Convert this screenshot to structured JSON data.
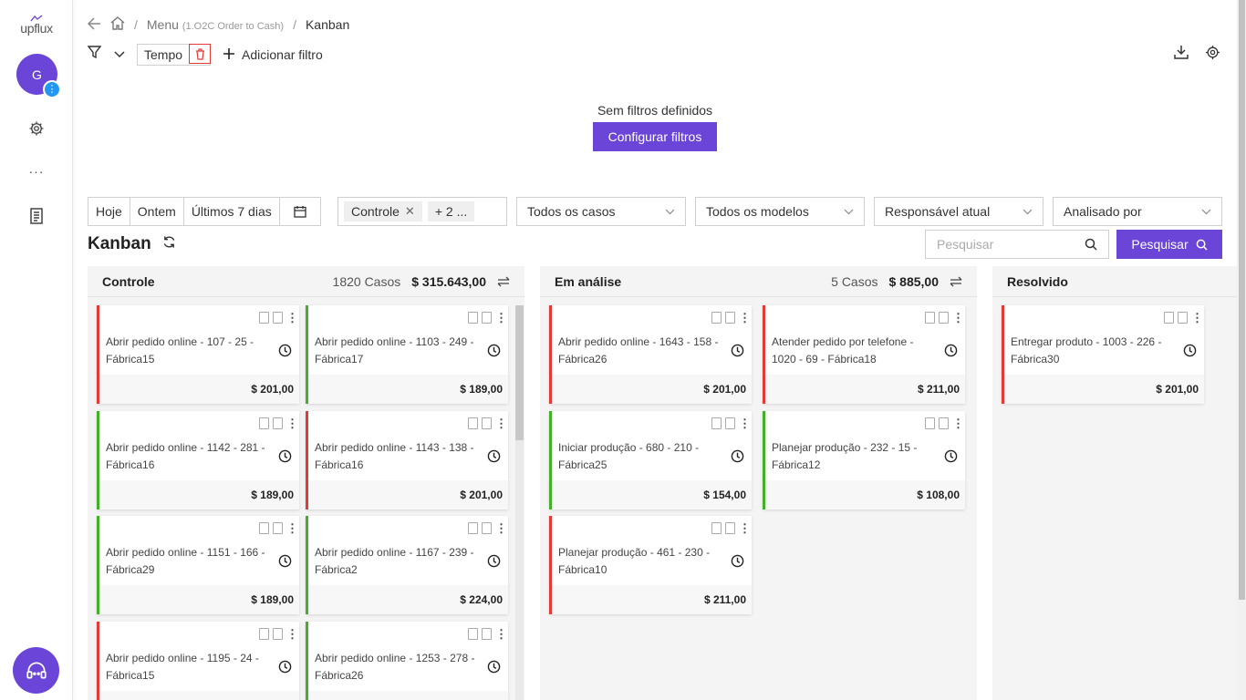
{
  "app": {
    "logo": "upflux",
    "avatar_initial": "G",
    "avatar_badge": "⋮",
    "sidebar_more": "···"
  },
  "breadcrumb": {
    "menu": "Menu",
    "menu_sub": "(1.O2C Order to Cash)",
    "current": "Kanban"
  },
  "filters": {
    "tempo_label": "Tempo",
    "add_filter_label": "Adicionar filtro",
    "empty_title": "Sem filtros definidos",
    "configure_label": "Configurar filtros"
  },
  "date_range": {
    "today": "Hoje",
    "yesterday": "Ontem",
    "last7": "Últimos 7 dias"
  },
  "activity_filter": {
    "chip": "Controle",
    "more": "+ 2 ..."
  },
  "selects": {
    "cases": "Todos os casos",
    "models": "Todos os modelos",
    "responsible": "Responsável atual",
    "analyzed": "Analisado por"
  },
  "kanban": {
    "title": "Kanban",
    "search_placeholder": "Pesquisar",
    "search_button": "Pesquisar"
  },
  "colors": {
    "accent": "#6a45d8",
    "late": "#e53935",
    "on_time": "#43b02a"
  },
  "columns": [
    {
      "name": "Controle",
      "count": "1820 Casos",
      "total": "$ 315.643,00",
      "cards": [
        {
          "title": "Abrir pedido online - 107 - 25 - Fábrica15",
          "value": "$ 201,00",
          "status": "red"
        },
        {
          "title": "Abrir pedido online - 1103 - 249 - Fábrica17",
          "value": "$ 189,00",
          "status": "green"
        },
        {
          "title": "Abrir pedido online - 1142 - 281 - Fábrica16",
          "value": "$ 189,00",
          "status": "green"
        },
        {
          "title": "Abrir pedido online - 1143 - 138 - Fábrica16",
          "value": "$ 201,00",
          "status": "red"
        },
        {
          "title": "Abrir pedido online - 1151 - 166 - Fábrica29",
          "value": "$ 189,00",
          "status": "green"
        },
        {
          "title": "Abrir pedido online - 1167 - 239 - Fábrica2",
          "value": "$ 224,00",
          "status": "green"
        },
        {
          "title": "Abrir pedido online - 1195 - 24 - Fábrica15",
          "value": "",
          "status": "red"
        },
        {
          "title": "Abrir pedido online - 1253 - 278 - Fábrica26",
          "value": "",
          "status": "green"
        }
      ]
    },
    {
      "name": "Em análise",
      "count": "5 Casos",
      "total": "$ 885,00",
      "cards": [
        {
          "title": "Abrir pedido online - 1643 - 158 - Fábrica26",
          "value": "$ 201,00",
          "status": "red"
        },
        {
          "title": "Atender pedido por telefone - 1020 - 69 - Fábrica18",
          "value": "$ 211,00",
          "status": "red"
        },
        {
          "title": "Iniciar produção - 680 - 210 - Fábrica25",
          "value": "$ 154,00",
          "status": "green"
        },
        {
          "title": "Planejar produção - 232 - 15 - Fábrica12",
          "value": "$ 108,00",
          "status": "green"
        },
        {
          "title": "Planejar produção - 461 - 230 - Fábrica10",
          "value": "$ 211,00",
          "status": "red"
        }
      ]
    },
    {
      "name": "Resolvido",
      "cards": [
        {
          "title": "Entregar produto - 1003 - 226 - Fábrica30",
          "value": "$ 201,00",
          "status": "red"
        }
      ]
    }
  ]
}
